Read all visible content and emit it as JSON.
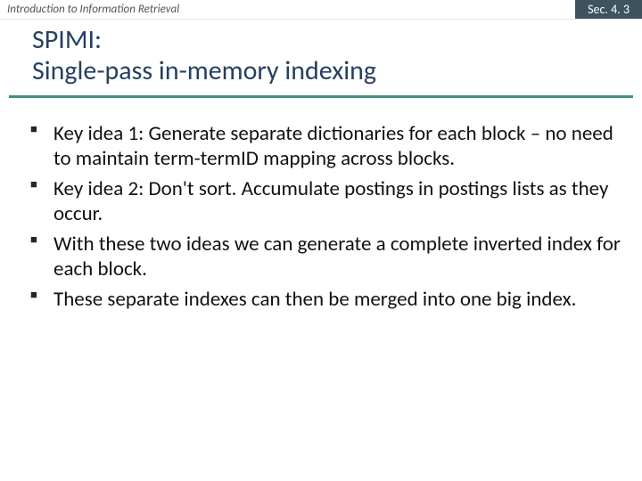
{
  "header": {
    "course": "Introduction to Information Retrieval",
    "section": "Sec. 4. 3"
  },
  "title": {
    "line1": "SPIMI:",
    "line2": "Single-pass in-memory indexing"
  },
  "bullets": [
    "Key idea 1: Generate separate dictionaries for each block – no need to maintain term-termID mapping across blocks.",
    "Key idea 2: Don't sort. Accumulate postings in postings lists as they occur.",
    "With these two ideas we can generate a complete inverted index for each block.",
    "These separate indexes can then be merged into one big index."
  ]
}
